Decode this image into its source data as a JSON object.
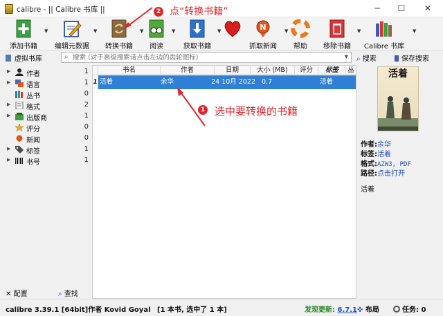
{
  "window": {
    "title": "calibre - || Calibre 书库 ||",
    "minimize": "─",
    "maximize": "☐",
    "close": "✕"
  },
  "toolbar": {
    "add_books": "添加书籍",
    "edit_metadata": "编辑元数据",
    "convert_books": "转换书籍",
    "view": "阅读",
    "get_books": "获取书籍",
    "fetch_news": "抓取新闻",
    "help": "帮助",
    "remove_books": "移除书籍",
    "library": "Calibre 书库"
  },
  "annotations": {
    "step1_badge": "1",
    "step1_text": "选中要转换的书籍",
    "step2_badge": "2",
    "step2_text": "点“转换书籍”",
    "accent_color": "#e0262a"
  },
  "searchbar": {
    "virtual_library": "虚拟书库",
    "placeholder": "搜索 (对于高级搜索请点击左边的齿轮图标)",
    "search_button": "搜索",
    "saved_search": "保存搜索"
  },
  "tag_browser": {
    "items": [
      {
        "label": "作者",
        "count": "1",
        "icon": "person-icon"
      },
      {
        "label": "语言",
        "count": "1",
        "icon": "language-icon"
      },
      {
        "label": "丛书",
        "count": "0",
        "icon": "series-icon"
      },
      {
        "label": "格式",
        "count": "2",
        "icon": "format-icon"
      },
      {
        "label": "出版商",
        "count": "1",
        "icon": "publisher-icon"
      },
      {
        "label": "评分",
        "count": "0",
        "icon": "star-icon"
      },
      {
        "label": "新闻",
        "count": "0",
        "icon": "news-icon"
      },
      {
        "label": "标签",
        "count": "1",
        "icon": "tag-icon"
      },
      {
        "label": "书号",
        "count": "1",
        "icon": "barcode-icon"
      }
    ],
    "configure": "配置",
    "find": "查找"
  },
  "book_table": {
    "columns": [
      "书名",
      "作者",
      "日期",
      "大小 (MB)",
      "评分",
      "标签",
      "丛"
    ],
    "rows": [
      {
        "index": "1",
        "title": "活着",
        "author": "余华",
        "date": "24 10月 2022",
        "size": "0.7",
        "rating": "",
        "tags": "活着"
      }
    ],
    "selection_color": "#2f7fd6"
  },
  "book_details": {
    "cover_title": "活着",
    "author_label": "作者:",
    "author": "余华",
    "tags_label": "标签:",
    "tags": "活着",
    "formats_label": "格式:",
    "formats": "AZW3, PDF",
    "path_label": "路径:",
    "path": "点击打开",
    "comments": "活着"
  },
  "statusbar": {
    "version": "calibre 3.39.1 [64bit]作者 Kovid Goyal",
    "count": "[1 本书, 选中了 1 本]",
    "update_label": "发现更新:",
    "update_version": "6.7.1",
    "layout": "布局",
    "jobs": "任务: 0"
  }
}
